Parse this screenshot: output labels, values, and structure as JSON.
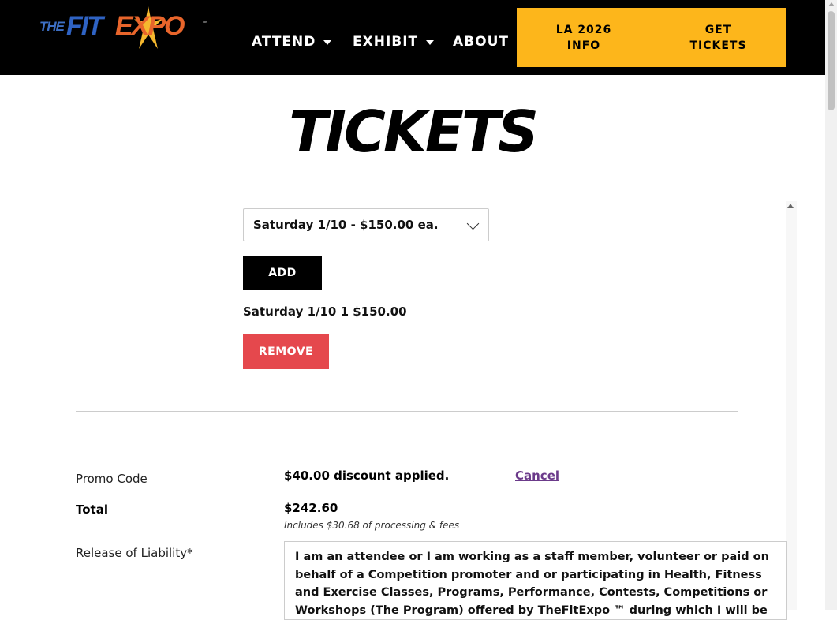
{
  "header": {
    "logo_text": "THEFITEXPO",
    "nav": [
      {
        "label": "ATTEND",
        "has_dropdown": true
      },
      {
        "label": "EXHIBIT",
        "has_dropdown": true
      },
      {
        "label": "ABOUT",
        "has_dropdown": false
      }
    ],
    "cta_info": "LA 2026\nINFO",
    "cta_tickets": "GET\nTICKETS",
    "accent_color": "#fdb61b"
  },
  "page": {
    "title": "TICKETS"
  },
  "ticket_selector": {
    "selected": "Saturday 1/10 - $150.00 ea.",
    "add_label": "ADD",
    "line_item": "Saturday 1/10 1 $150.00",
    "remove_label": "REMOVE"
  },
  "form": {
    "promo_label": "Promo Code",
    "promo_value": "$40.00 discount applied.",
    "promo_cancel": "Cancel",
    "total_label": "Total",
    "total_value": "$242.60",
    "total_note": "Includes $30.68 of processing & fees",
    "liability_label": "Release of Liability*",
    "liability_text": "I am an attendee or I am working as a staff member, volunteer or paid on behalf of a Competition promoter and or participating in Health, Fitness and Exercise Classes, Programs, Performance, Contests, Competitions or Workshops (The Program) offered by TheFitExpo ™ during which I will be"
  },
  "colors": {
    "remove": "#e5484d",
    "link": "#6b3a8a"
  }
}
